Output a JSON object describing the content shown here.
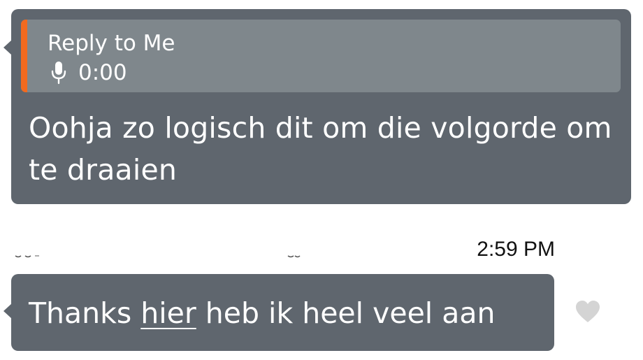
{
  "message_1": {
    "reply": {
      "title": "Reply to Me",
      "audio_icon": "microphone-icon",
      "duration": "0:00",
      "accent_color": "#f26a1f"
    },
    "text": "Oohja zo logisch dit om die volgorde om te draaien"
  },
  "message_2": {
    "timestamp": "2:59 PM",
    "text_before": "Thanks ",
    "text_link": "hier",
    "text_after": " heb ik heel veel aan",
    "reaction_icon": "heart-icon"
  },
  "colors": {
    "bubble": "#5f666e",
    "reply_box": "#7f878c",
    "heart": "#d4d4d4"
  }
}
